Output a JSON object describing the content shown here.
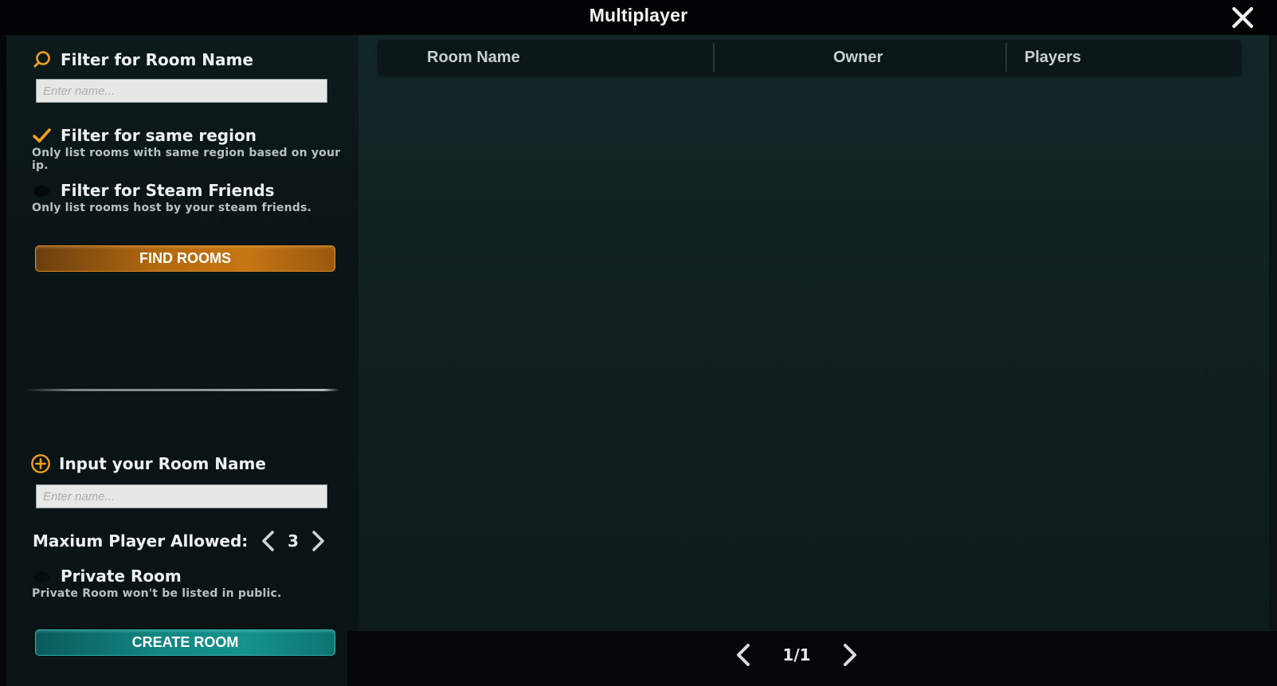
{
  "window": {
    "title": "Multiplayer"
  },
  "icons": {
    "close": "close-icon",
    "search": "search-icon",
    "checkmark": "checkmark-icon",
    "add": "add-circle-icon",
    "chevron_left": "chevron-left-icon",
    "chevron_right": "chevron-right-icon"
  },
  "colors": {
    "accent_orange": "#f0a020",
    "find_button": "#b2680f",
    "create_button": "#118581"
  },
  "filters": {
    "room_name": {
      "heading": "Filter for Room Name",
      "placeholder": "Enter name...",
      "value": ""
    },
    "same_region": {
      "label": "Filter for same region",
      "description": "Only list rooms with same region based on your ip.",
      "checked": true
    },
    "steam_friends": {
      "label": "Filter for Steam Friends",
      "description": "Only list rooms host by your steam friends.",
      "checked": false
    },
    "find_button_label": "FIND ROOMS"
  },
  "create": {
    "heading": "Input your Room Name",
    "placeholder": "Enter name...",
    "value": "",
    "max_players_label": "Maxium Player Allowed:",
    "max_players_value": "3",
    "private_room": {
      "label": "Private Room",
      "description": "Private Room won't be listed in public.",
      "checked": false
    },
    "create_button_label": "CREATE ROOM"
  },
  "room_table": {
    "columns": [
      "Room Name",
      "Owner",
      "Players"
    ],
    "rows": []
  },
  "pagination": {
    "text": "1/1"
  }
}
